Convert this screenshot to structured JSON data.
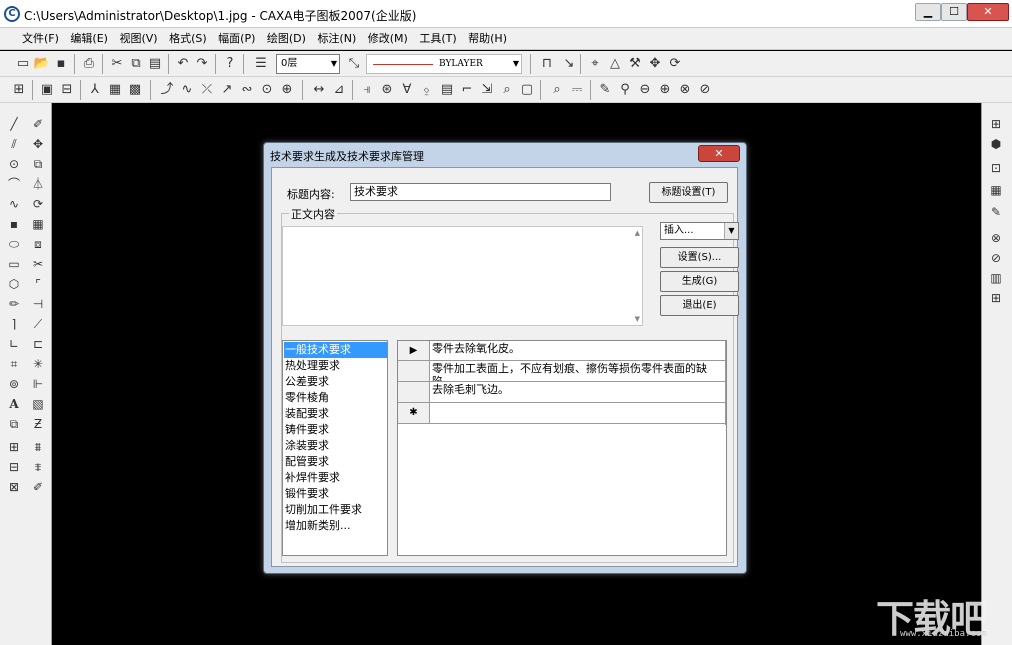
{
  "window": {
    "title": "C:\\Users\\Administrator\\Desktop\\1.jpg - CAXA电子图板2007(企业版)",
    "app_icon_letter": "C",
    "min": "▁",
    "max": "☐",
    "close": "✕"
  },
  "menu": [
    "文件(F)",
    "编辑(E)",
    "视图(V)",
    "格式(S)",
    "幅面(P)",
    "绘图(D)",
    "标注(N)",
    "修改(M)",
    "工具(T)",
    "帮助(H)"
  ],
  "toolbar": {
    "layer": "0层",
    "linetype": "BYLAYER"
  },
  "dialog": {
    "title": "技术要求生成及技术要求库管理",
    "close": "✕",
    "title_label": "标题内容:",
    "title_value": "技术要求",
    "title_settings_button": "标题设置(T)",
    "body_group_label": "正文内容",
    "insert_combo": "插入...",
    "settings_button": "设置(S)...",
    "generate_button": "生成(G)",
    "exit_button": "退出(E)",
    "categories": [
      "一般技术要求",
      "热处理要求",
      "公差要求",
      "零件棱角",
      "装配要求",
      "铸件要求",
      "涂装要求",
      "配管要求",
      "补焊件要求",
      "锻件要求",
      "切削加工件要求",
      "增加新类别..."
    ],
    "selected_category": "一般技术要求",
    "grid_rows": [
      {
        "marker": "▶",
        "text": "零件去除氧化皮。"
      },
      {
        "marker": "",
        "text": "零件加工表面上，不应有划痕、擦伤等损伤零件表面的缺陷。"
      },
      {
        "marker": "",
        "text": "去除毛刺飞边。"
      },
      {
        "marker": "✱",
        "text": ""
      }
    ]
  },
  "watermark": {
    "brand": "下载吧",
    "url": "www.xiazaiba.com"
  }
}
